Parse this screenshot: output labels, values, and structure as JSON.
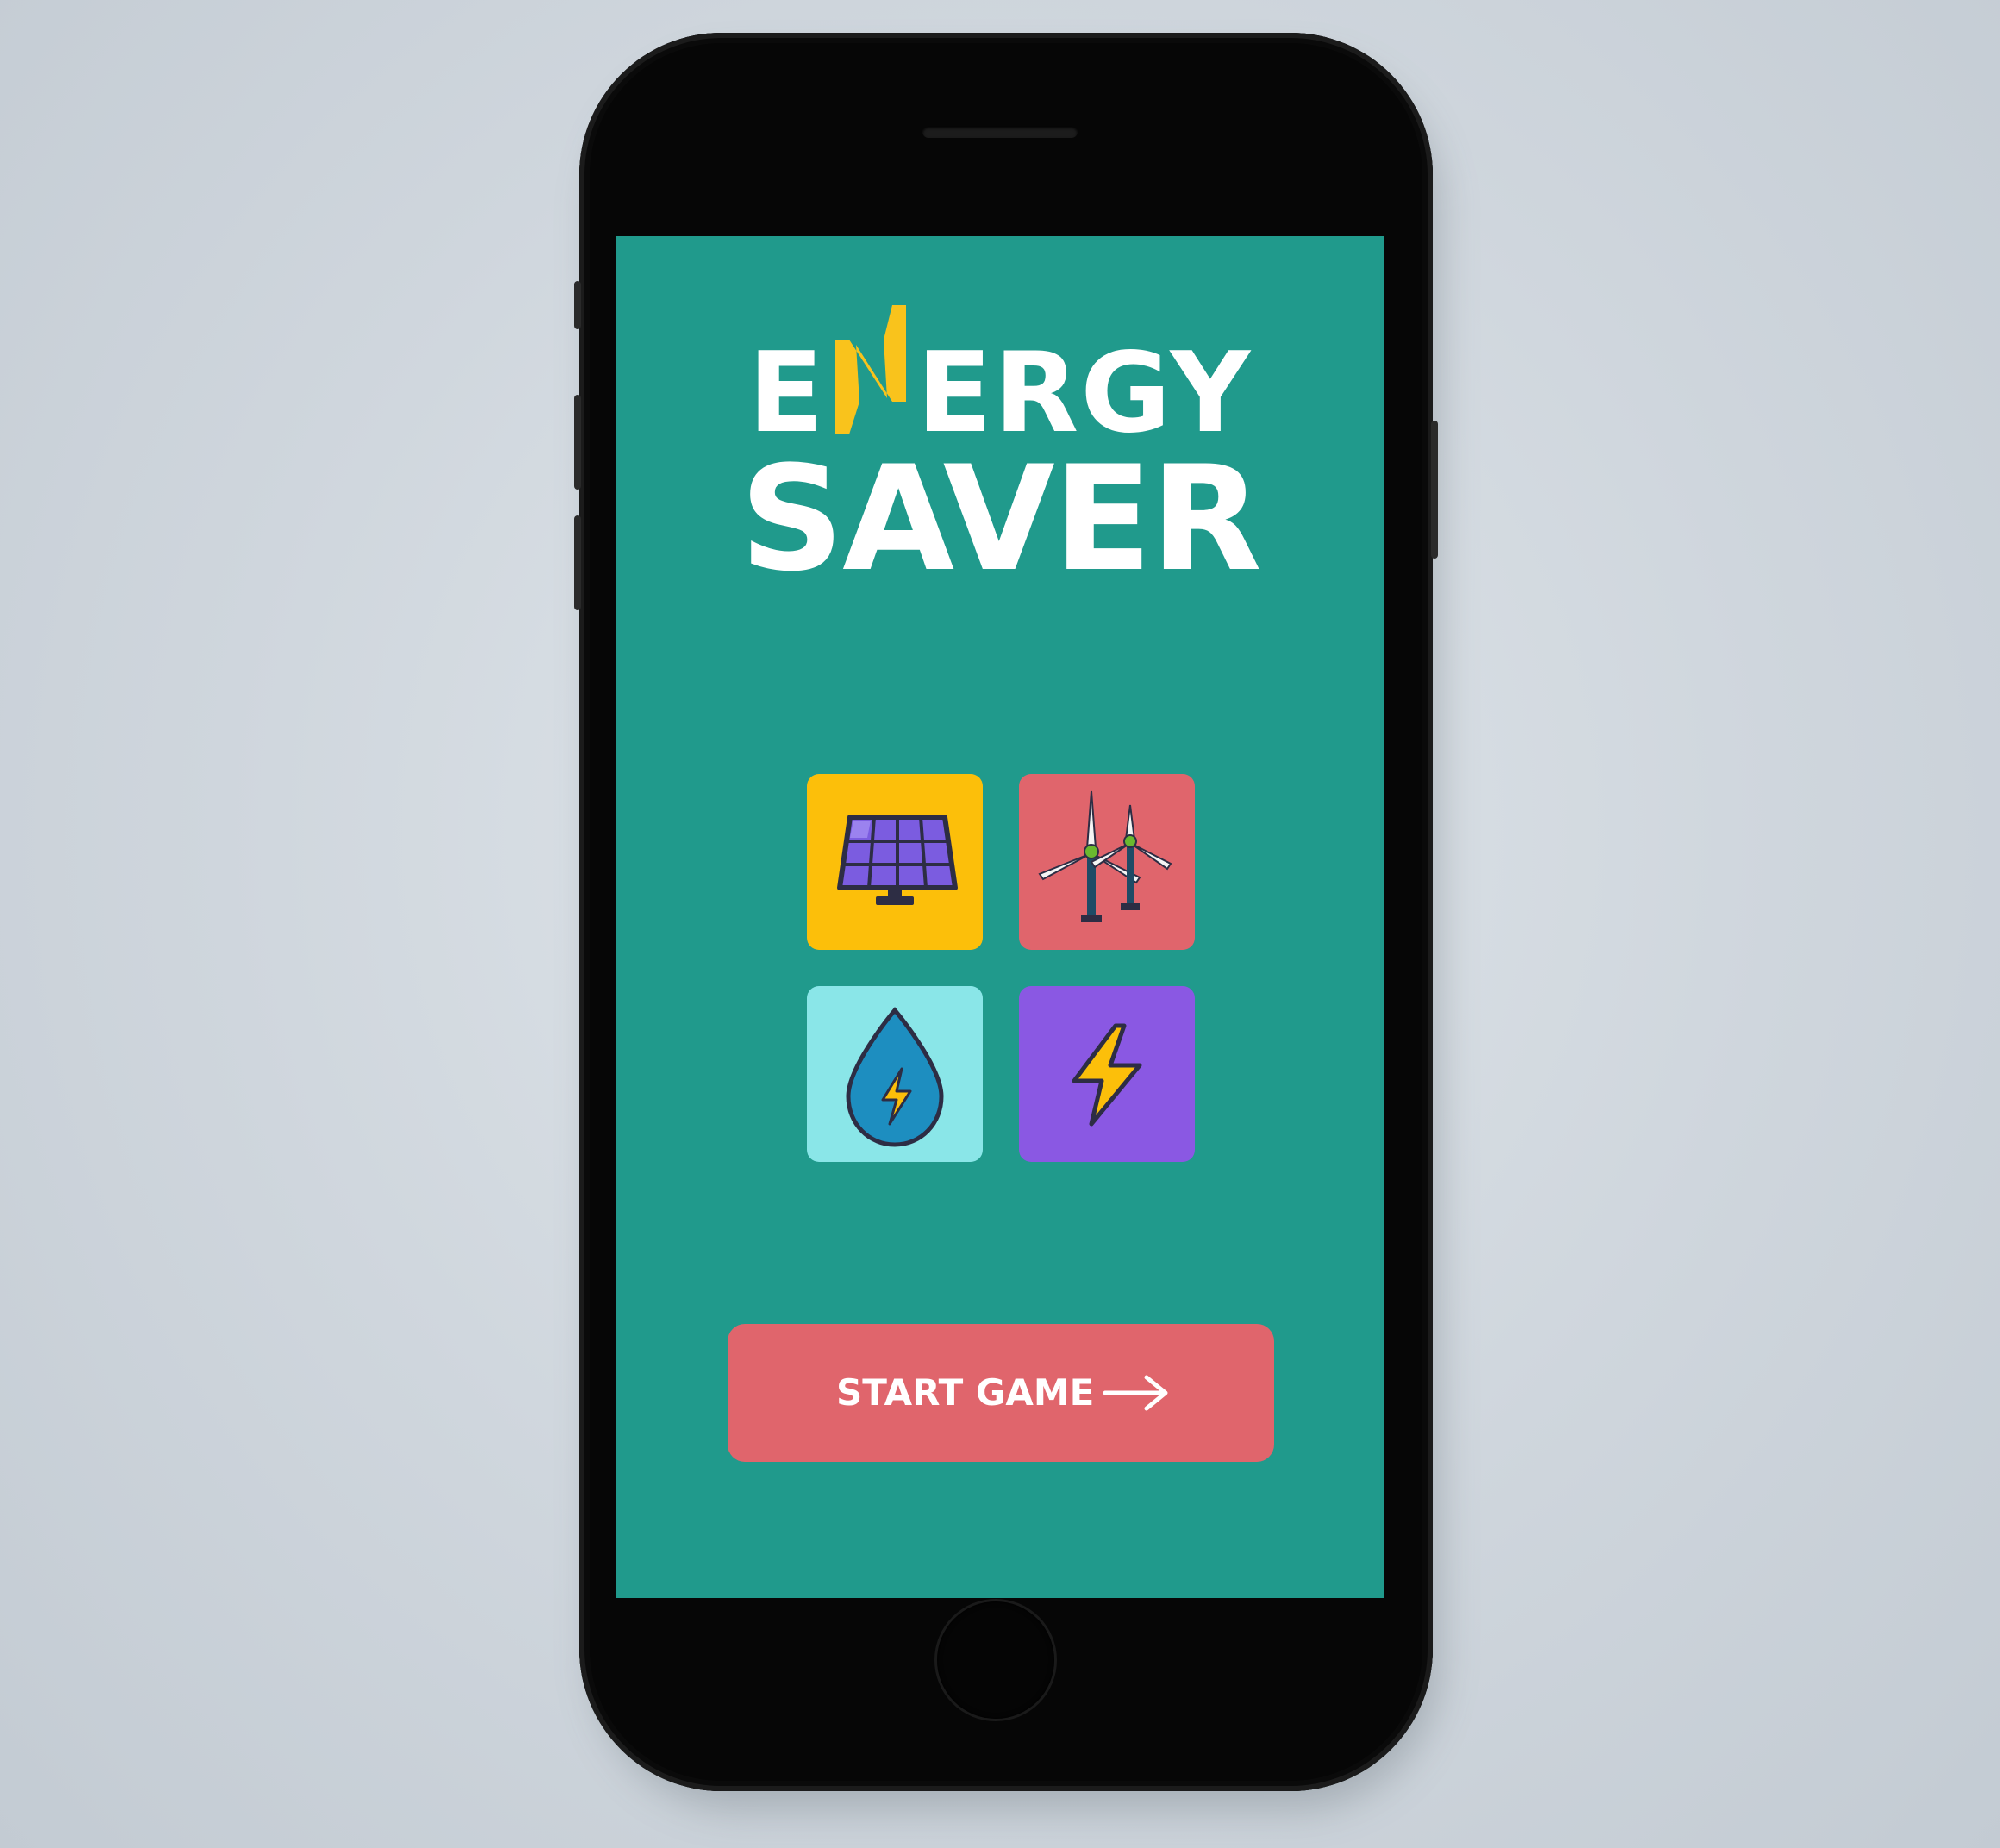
{
  "app": {
    "title_line1": "ENERGY",
    "title_line2": "SAVER",
    "accent_letter_color": "#f9c31c",
    "screen_background": "#209a8c"
  },
  "tiles": [
    {
      "name": "solar-panel",
      "icon": "solar-panel-icon",
      "color": "#fcbf0a"
    },
    {
      "name": "wind-turbines",
      "icon": "wind-turbine-icon",
      "color": "#e0656c"
    },
    {
      "name": "hydro-power",
      "icon": "water-drop-bolt-icon",
      "color": "#8ae6e8"
    },
    {
      "name": "electricity",
      "icon": "lightning-bolt-icon",
      "color": "#8a58e3"
    }
  ],
  "start_button": {
    "label": "START GAME",
    "icon": "arrow-right-icon",
    "color": "#e0656c"
  }
}
